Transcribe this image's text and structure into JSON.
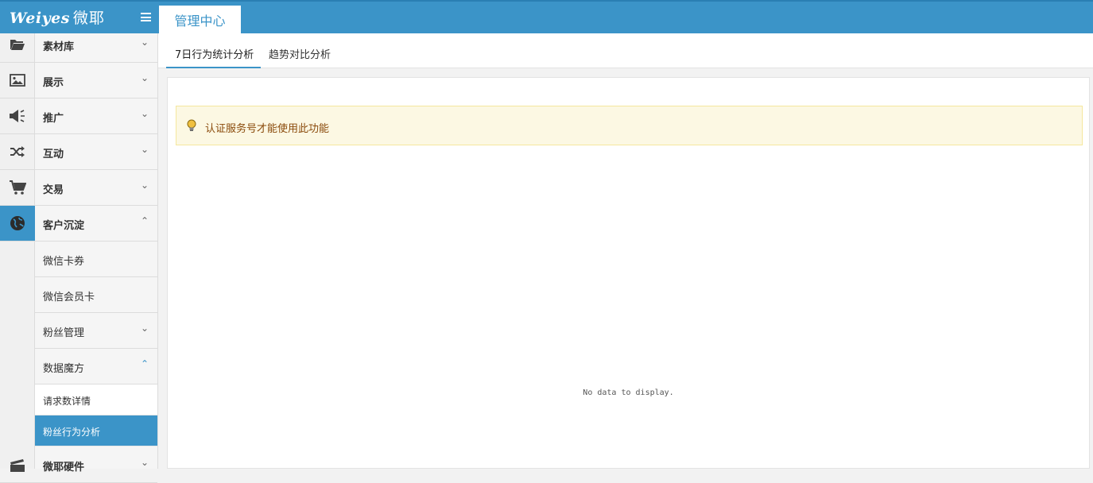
{
  "header": {
    "logo_en": "Weiyes",
    "logo_cn": "微耶",
    "active_tab": "管理中心"
  },
  "sidebar": {
    "items": [
      {
        "label": "素材库",
        "icon": "folder-open-icon"
      },
      {
        "label": "展示",
        "icon": "image-icon"
      },
      {
        "label": "推广",
        "icon": "megaphone-icon"
      },
      {
        "label": "互动",
        "icon": "shuffle-icon"
      },
      {
        "label": "交易",
        "icon": "cart-icon"
      },
      {
        "label": "客户沉淀",
        "icon": "globe-icon"
      },
      {
        "label": "微耶硬件",
        "icon": "film-icon"
      }
    ],
    "sub_items": [
      {
        "label": "微信卡券"
      },
      {
        "label": "微信会员卡"
      },
      {
        "label": "粉丝管理"
      },
      {
        "label": "数据魔方"
      }
    ],
    "leaves": [
      {
        "label": "请求数详情"
      },
      {
        "label": "粉丝行为分析"
      }
    ]
  },
  "tabs": [
    {
      "label": "7日行为统计分析"
    },
    {
      "label": "趋势对比分析"
    }
  ],
  "notice": {
    "text": "认证服务号才能使用此功能"
  },
  "chart": {
    "empty_text": "No data to display."
  },
  "colors": {
    "accent": "#3b94c8",
    "notice_bg": "#fcf8e3",
    "notice_text": "#8a4a0b"
  }
}
